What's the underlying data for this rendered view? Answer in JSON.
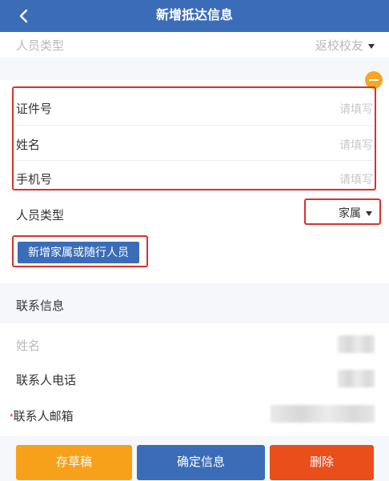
{
  "header": {
    "title": "新增抵达信息"
  },
  "top_row": {
    "label": "人员类型",
    "value": "返校校友"
  },
  "companion": {
    "fields": [
      {
        "label": "证件号",
        "placeholder": "请填写"
      },
      {
        "label": "姓名",
        "placeholder": "请填写"
      },
      {
        "label": "手机号",
        "placeholder": "请填写"
      }
    ],
    "type_label": "人员类型",
    "type_value": "家属",
    "add_button": "新增家属或随行人员"
  },
  "contact": {
    "section_title": "联系信息",
    "name_label": "姓名",
    "phone_label": "联系人电话",
    "email_required_mark": "*",
    "email_label": "联系人邮箱"
  },
  "footer": {
    "draft": "存草稿",
    "confirm": "确定信息",
    "delete": "删除"
  },
  "colors": {
    "header": "#3b6cb7",
    "accent_orange": "#f7a11a",
    "delete_red": "#e94e1b",
    "highlight_red": "#d8322c"
  }
}
